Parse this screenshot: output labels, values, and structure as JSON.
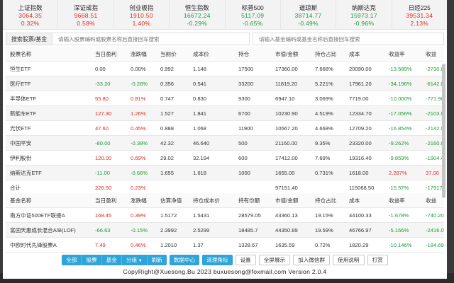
{
  "indices": [
    {
      "name": "上证指数",
      "value": "3064.35",
      "pct": "0.32%",
      "dir": "up"
    },
    {
      "name": "深证成指",
      "value": "9668.51",
      "pct": "0.58%",
      "dir": "up"
    },
    {
      "name": "创业板指",
      "value": "1910.50",
      "pct": "1.40%",
      "dir": "up"
    },
    {
      "name": "恒生指数",
      "value": "16672.24",
      "pct": "-0.29%",
      "dir": "down"
    },
    {
      "name": "标普500",
      "value": "5117.09",
      "pct": "-0.65%",
      "dir": "down"
    },
    {
      "name": "道琼斯",
      "value": "38714.77",
      "pct": "-0.49%",
      "dir": "down"
    },
    {
      "name": "纳斯达克",
      "value": "15973.17",
      "pct": "-0.96%",
      "dir": "down"
    },
    {
      "name": "日经225",
      "value": "39531.34",
      "pct": "2.13%",
      "dir": "up"
    }
  ],
  "search": {
    "stock_label": "搜索股票/基金",
    "stock_placeholder": "请输入股票编码或股票名称后直接回车搜索",
    "fund_placeholder": "请输入基金编码或基金名称后直接回车搜索"
  },
  "stock_table": {
    "headers": [
      "股票名称",
      "当日盈利",
      "涨跌幅",
      "当前价",
      "成本价",
      "持仓",
      "市值/金额",
      "持仓占比",
      "成本",
      "收益率",
      "收益"
    ],
    "rows": [
      [
        "恒生ETF",
        "0.00",
        "0.00%",
        "0.992",
        "1.148",
        "17500",
        "17360.00",
        "7.668%",
        "20090.00",
        "-13.589%",
        "-2730.0"
      ],
      [
        "医疗ETF",
        "-33.20",
        "-0.28%",
        "0.356",
        "0.541",
        "33200",
        "11819.20",
        "5.221%",
        "17961.20",
        "-34.196%",
        "-6142.0"
      ],
      [
        "半导体ETF",
        "55.80",
        "0.81%",
        "0.747",
        "0.830",
        "9300",
        "6947.10",
        "3.069%",
        "7719.00",
        "-10.000%",
        "-771.90"
      ],
      [
        "新能车ETF",
        "127.30",
        "1.26%",
        "1.527",
        "1.841",
        "6700",
        "10230.90",
        "4.519%",
        "12334.70",
        "-17.056%",
        "-2103.8"
      ],
      [
        "光伏ETF",
        "47.60",
        "0.45%",
        "0.888",
        "1.068",
        "11900",
        "10567.20",
        "4.668%",
        "12709.20",
        "-16.854%",
        "-2142.0"
      ],
      [
        "中国平安",
        "-80.00",
        "-0.38%",
        "42.32",
        "46.640",
        "500",
        "21160.00",
        "9.35%",
        "23320.00",
        "-9.262%",
        "-2160.0"
      ],
      [
        "伊利股份",
        "120.00",
        "0.69%",
        "29.02",
        "32.194",
        "600",
        "17412.00",
        "7.69%",
        "19316.40",
        "-9.859%",
        "-1904.4"
      ],
      [
        "纳斯达克ETF",
        "-11.00",
        "-0.66%",
        "1.655",
        "1.618",
        "1000",
        "1655.00",
        "0.731%",
        "1618.00",
        "2.287%",
        "37.00"
      ],
      [
        "合计",
        "226.50",
        "0.23%",
        "",
        "",
        "",
        "97151.40",
        "",
        "115068.50",
        "-15.57%",
        "-17917."
      ]
    ],
    "row_colors": [
      [
        "dark",
        "dark",
        "dark",
        "dark",
        "dark",
        "dark",
        "dark",
        "dark",
        "dark",
        "down",
        "down"
      ],
      [
        "dark",
        "down",
        "down",
        "dark",
        "dark",
        "dark",
        "dark",
        "dark",
        "dark",
        "down",
        "down"
      ],
      [
        "dark",
        "up",
        "up",
        "dark",
        "dark",
        "dark",
        "dark",
        "dark",
        "dark",
        "down",
        "down"
      ],
      [
        "dark",
        "up",
        "up",
        "dark",
        "dark",
        "dark",
        "dark",
        "dark",
        "dark",
        "down",
        "down"
      ],
      [
        "dark",
        "up",
        "up",
        "dark",
        "dark",
        "dark",
        "dark",
        "dark",
        "dark",
        "down",
        "down"
      ],
      [
        "dark",
        "down",
        "down",
        "dark",
        "dark",
        "dark",
        "dark",
        "dark",
        "dark",
        "down",
        "down"
      ],
      [
        "dark",
        "up",
        "up",
        "dark",
        "dark",
        "dark",
        "dark",
        "dark",
        "dark",
        "down",
        "down"
      ],
      [
        "dark",
        "down",
        "down",
        "dark",
        "dark",
        "dark",
        "dark",
        "dark",
        "dark",
        "up",
        "up"
      ],
      [
        "dark",
        "up",
        "up",
        "dark",
        "dark",
        "dark",
        "dark",
        "dark",
        "dark",
        "down",
        "down"
      ]
    ]
  },
  "fund_table": {
    "headers": [
      "基金名称",
      "当日盈利",
      "涨跌幅",
      "估算净值",
      "持仓成本价",
      "持有份额",
      "市值/金额",
      "持仓占比",
      "成本",
      "收益率",
      "收益"
    ],
    "rows": [
      [
        "南方中证500ETF联接A",
        "168.45",
        "0.39%",
        "1.5172",
        "1.5431",
        "28579.05",
        "43360.13",
        "19.15%",
        "44100.33",
        "-1.678%",
        "-740.20"
      ],
      [
        "富国天惠成长混合A/B(LOF)",
        "-66.63",
        "-0.15%",
        "2.3992",
        "2.5299",
        "18485.7",
        "44350.89",
        "19.59%",
        "46766.97",
        "-5.166%",
        "-2416.0"
      ],
      [
        "中欧时代先锋股票A",
        "7.49",
        "0.46%",
        "1.2010",
        "1.37",
        "1328.67",
        "1635.59",
        "0.72%",
        "1820.29",
        "-10.146%",
        "-184.69"
      ]
    ],
    "row_colors": [
      [
        "dark",
        "up",
        "up",
        "dark",
        "dark",
        "dark",
        "dark",
        "dark",
        "dark",
        "down",
        "down"
      ],
      [
        "dark",
        "down",
        "down",
        "dark",
        "dark",
        "dark",
        "dark",
        "dark",
        "dark",
        "down",
        "down"
      ],
      [
        "dark",
        "up",
        "up",
        "dark",
        "dark",
        "dark",
        "dark",
        "dark",
        "dark",
        "down",
        "down"
      ]
    ]
  },
  "toolbar": {
    "group1": [
      "全部",
      "股票",
      "基金",
      "分组",
      "刷新"
    ],
    "data_center": "数据中心",
    "clear_badge": "清理角标",
    "settings": "设置",
    "fullscreen": "全屏展示",
    "join_wechat": "加入微信群",
    "help": "使用说明",
    "tip": "打赏"
  },
  "copyright": "CopyRight@Xuesong.Bu 2023 buxuesong@foxmail.com Version 2.0.4",
  "colors": {
    "up": "#e0271f",
    "down": "#1f9a3a",
    "accent": "#2fa4d8"
  }
}
